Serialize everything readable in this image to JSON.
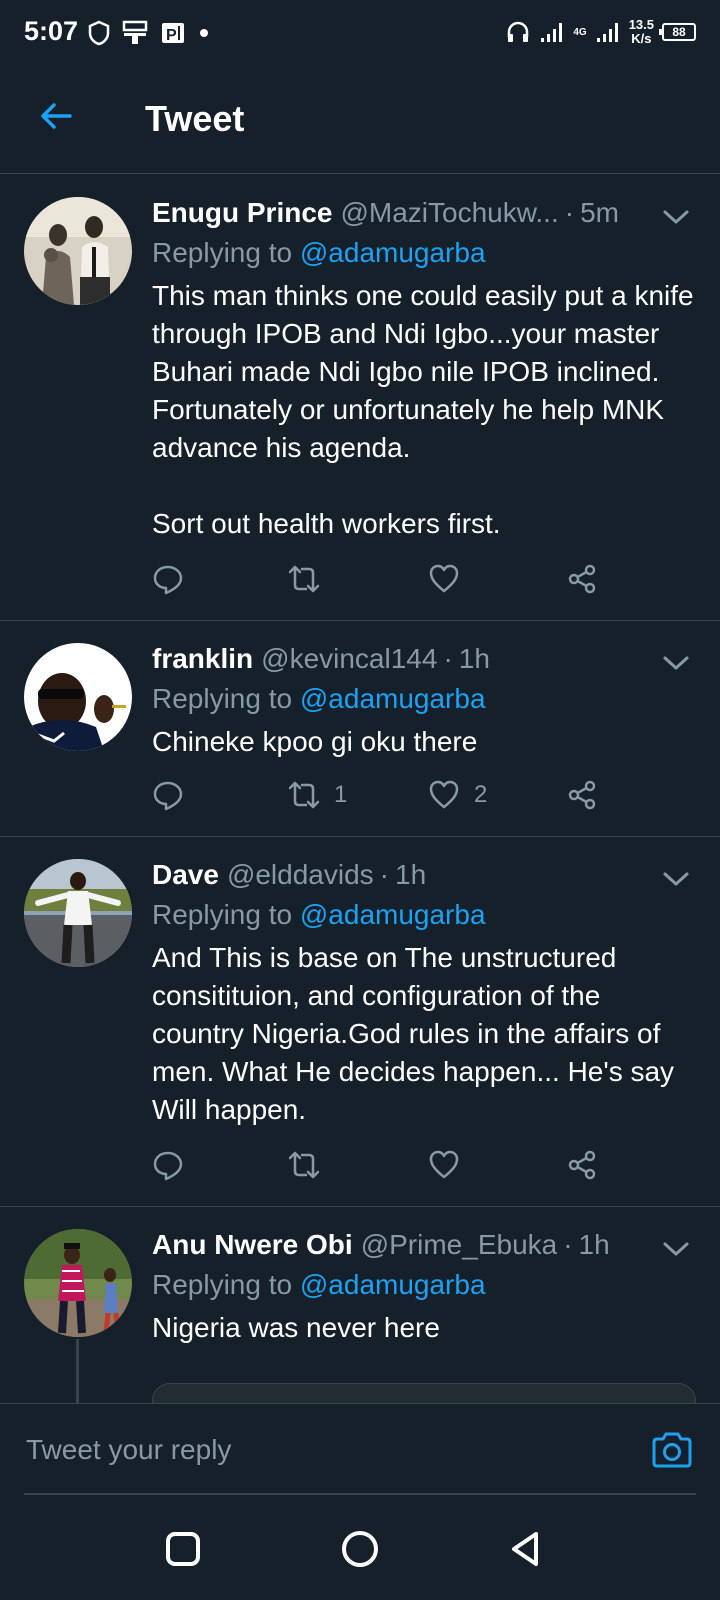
{
  "status_bar": {
    "time": "5:07",
    "net_speed_value": "13.5",
    "net_speed_unit": "K/s",
    "network_type": "4G",
    "battery": "88"
  },
  "header": {
    "title": "Tweet"
  },
  "tweets": [
    {
      "name": "Enugu Prince",
      "handle": "@MaziTochukw...",
      "time": "5m",
      "replying_label": "Replying to",
      "reply_to": "@adamugarba",
      "text": "This man thinks one could easily put a knife through IPOB and Ndi Igbo...your master Buhari made Ndi Igbo nile IPOB inclined. Fortunately or unfortunately he help MNK advance his agenda.\n\nSort out health workers first.",
      "retweets": "",
      "likes": ""
    },
    {
      "name": "franklin",
      "handle": "@kevincal144",
      "time": "1h",
      "replying_label": "Replying to",
      "reply_to": "@adamugarba",
      "text": "Chineke kpoo gi oku there",
      "retweets": "1",
      "likes": "2"
    },
    {
      "name": "Dave",
      "handle": "@elddavids",
      "time": "1h",
      "replying_label": "Replying to",
      "reply_to": "@adamugarba",
      "text": "And This is base on The unstructured consitituion, and configuration of the country Nigeria.God rules in the affairs of men. What He decides happen... He's say Will happen.",
      "retweets": "",
      "likes": ""
    },
    {
      "name": "Anu Nwere Obi",
      "handle": "@Prime_Ebuka",
      "time": "1h",
      "replying_label": "Replying to",
      "reply_to": "@adamugarba",
      "text": "Nigeria was never here",
      "retweets": "",
      "likes": ""
    }
  ],
  "reply_bar": {
    "placeholder": "Tweet your reply"
  },
  "colors": {
    "background": "#15202b",
    "accent": "#1da1f2",
    "muted": "#8899a6",
    "divider": "#38444d"
  },
  "icons": [
    "back-arrow-icon",
    "chevron-down-icon",
    "reply-icon",
    "retweet-icon",
    "like-icon",
    "share-icon",
    "camera-icon",
    "square-icon",
    "circle-icon",
    "triangle-back-icon"
  ]
}
